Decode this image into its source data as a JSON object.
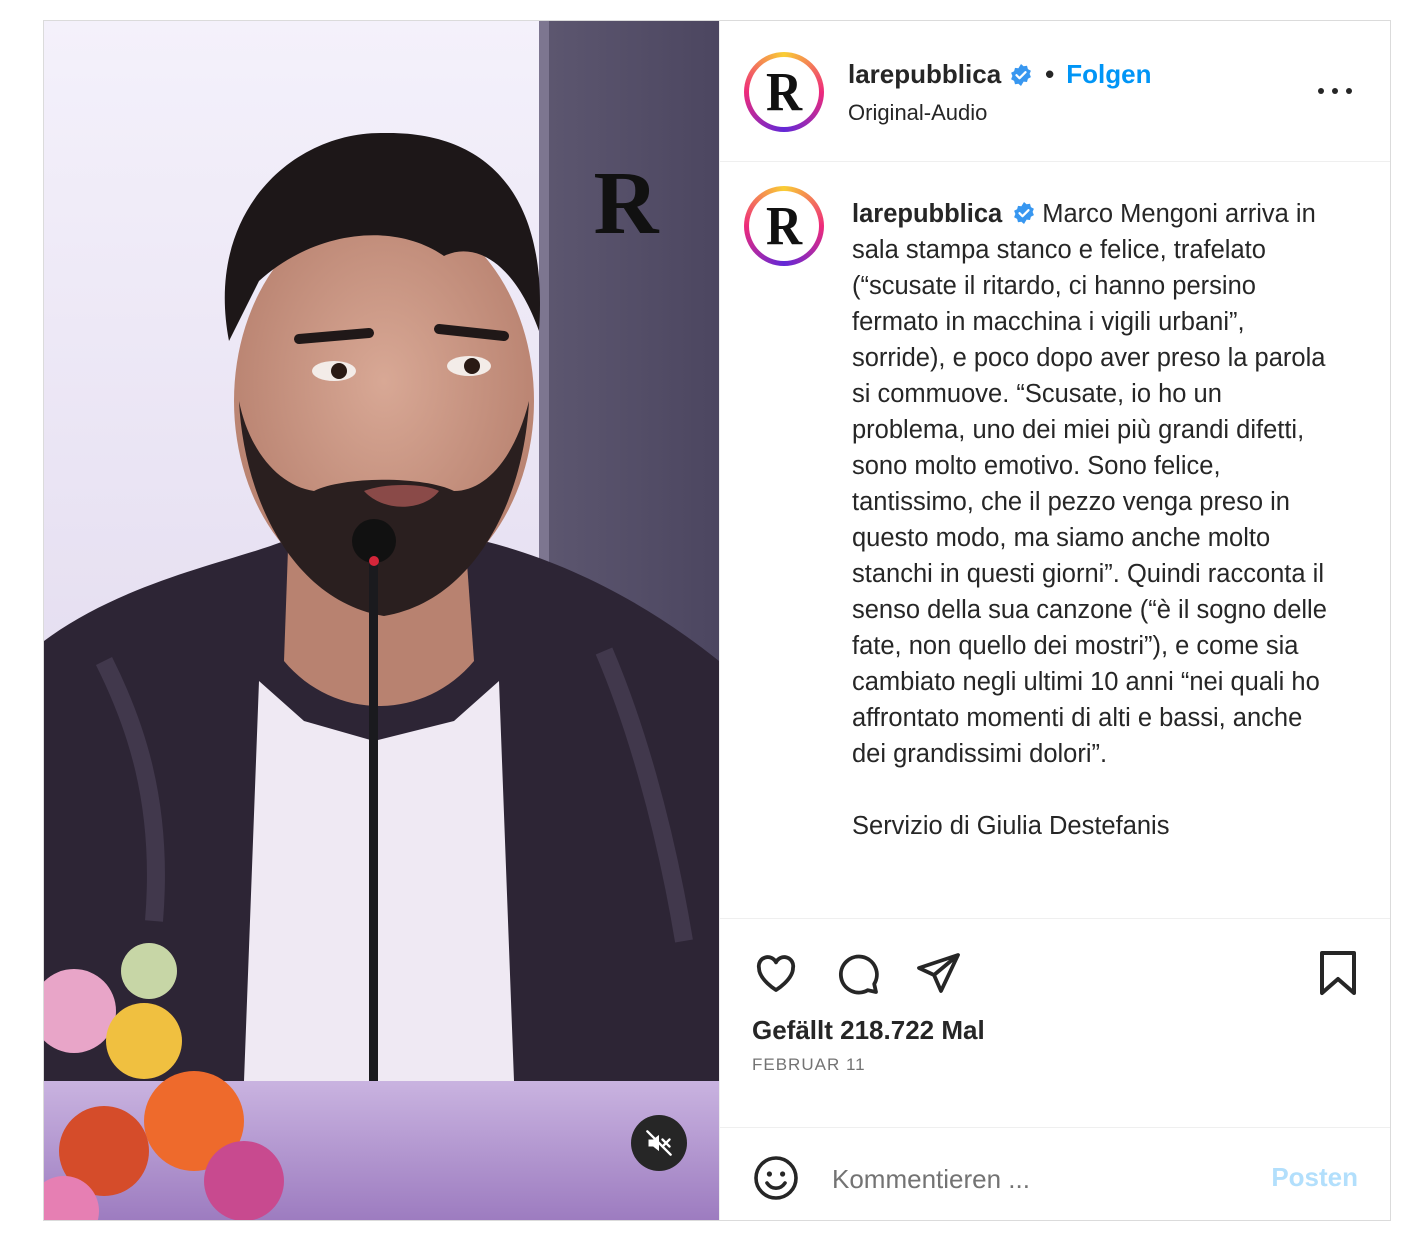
{
  "header": {
    "avatar_letter": "R",
    "username": "larepubblica",
    "separator": "•",
    "follow_label": "Folgen",
    "audio_label": "Original-Audio"
  },
  "media": {
    "watermark_letter": "R"
  },
  "caption": {
    "username": "larepubblica",
    "text": "Marco Mengoni arriva in sala stampa stanco e felice, trafelato (“scusate il ritardo, ci hanno persino fermato in macchina i vigili urbani”, sorride), e poco dopo aver preso la parola si commuove. “Scusate, io ho un problema, uno dei miei più grandi difetti, sono molto emotivo. Sono felice, tantissimo, che il pezzo venga preso in questo modo, ma siamo anche molto stanchi in questi giorni”. Quindi racconta il senso della sua canzone (“è il sogno delle fate, non quello dei mostri”), e come sia cambiato negli ultimi 10 anni “nei quali ho affrontato momenti di alti e bassi, anche dei grandissimi dolori”.\n\nServizio di Giulia Destefanis"
  },
  "engagement": {
    "likes_label": "Gefällt 218.722 Mal",
    "date_label": "FEBRUAR 11"
  },
  "comment": {
    "placeholder": "Kommentieren ...",
    "post_label": "Posten"
  },
  "colors": {
    "accent": "#0095f6",
    "verified": "#3897f0",
    "post_disabled": "#b2dffc"
  }
}
